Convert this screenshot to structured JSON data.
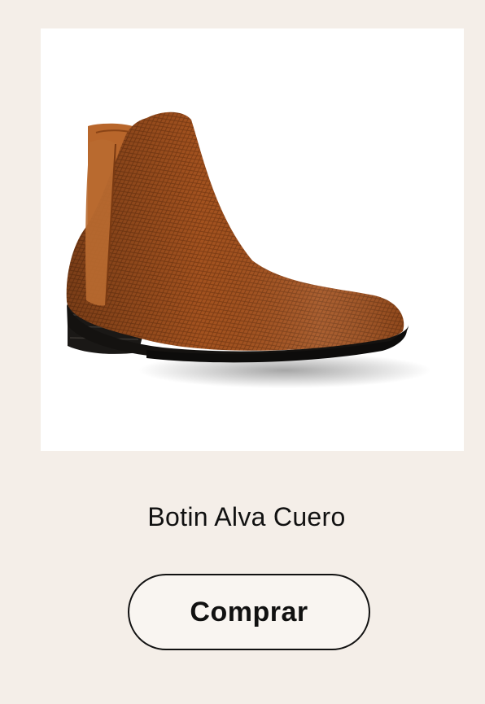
{
  "product": {
    "name": "Botin Alva Cuero",
    "image_alt": "Botin Alva Cuero",
    "image_icon": "brown-leather-chelsea-boot",
    "leather_color": "#a04f1c"
  },
  "actions": {
    "buy_label": "Comprar"
  },
  "colors": {
    "background": "#f4eee8",
    "button_border": "#111111",
    "text": "#111111"
  }
}
